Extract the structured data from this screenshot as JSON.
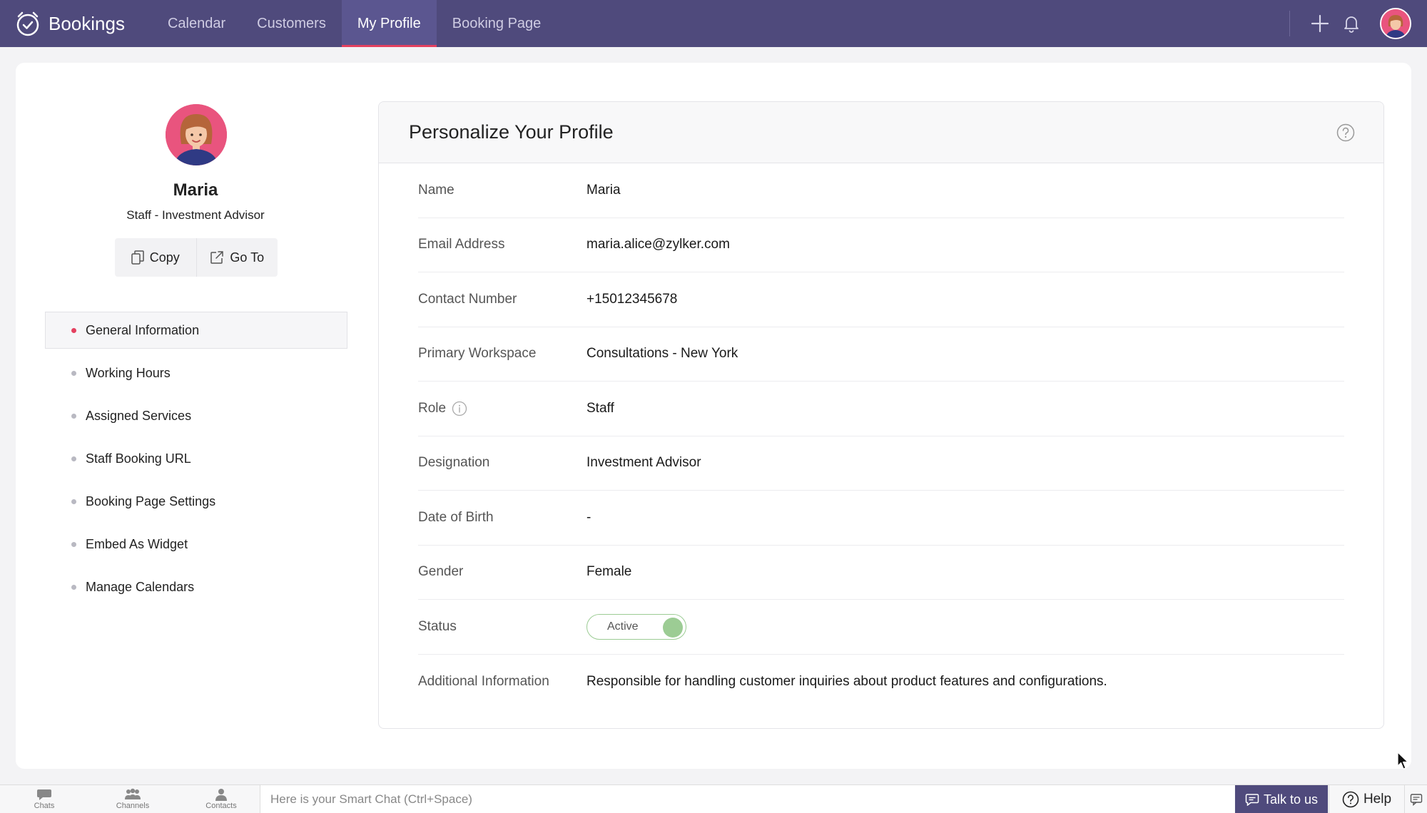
{
  "app": {
    "name": "Bookings"
  },
  "nav": {
    "items": [
      {
        "label": "Calendar"
      },
      {
        "label": "Customers"
      },
      {
        "label": "My Profile",
        "active": true
      },
      {
        "label": "Booking Page"
      }
    ]
  },
  "profile": {
    "name": "Maria",
    "role": "Staff - Investment Advisor",
    "copy_label": "Copy",
    "goto_label": "Go To"
  },
  "side_menu": {
    "items": [
      {
        "label": "General Information",
        "active": true
      },
      {
        "label": "Working Hours"
      },
      {
        "label": "Assigned Services"
      },
      {
        "label": "Staff Booking URL"
      },
      {
        "label": "Booking Page Settings"
      },
      {
        "label": "Embed As Widget"
      },
      {
        "label": "Manage Calendars"
      }
    ]
  },
  "panel": {
    "title": "Personalize Your Profile",
    "fields": [
      {
        "label": "Name",
        "value": "Maria"
      },
      {
        "label": "Email Address",
        "value": "maria.alice@zylker.com"
      },
      {
        "label": "Contact Number",
        "value": "+15012345678"
      },
      {
        "label": "Primary Workspace",
        "value": "Consultations - New York"
      },
      {
        "label": "Role",
        "value": "Staff"
      },
      {
        "label": "Designation",
        "value": "Investment Advisor"
      },
      {
        "label": "Date of Birth",
        "value": "-"
      },
      {
        "label": "Gender",
        "value": "Female"
      },
      {
        "label": "Status",
        "value": "Active"
      },
      {
        "label": "Additional Information",
        "value": "Responsible for handling customer inquiries about product features and configurations."
      }
    ]
  },
  "bottombar": {
    "dock": [
      {
        "label": "Chats",
        "icon": "chat-icon"
      },
      {
        "label": "Channels",
        "icon": "channels-icon"
      },
      {
        "label": "Contacts",
        "icon": "contacts-icon"
      }
    ],
    "smart_chat_placeholder": "Here is your Smart Chat (Ctrl+Space)",
    "talk_label": "Talk to us",
    "help_label": "Help"
  },
  "colors": {
    "topbar": "#4f4a7c",
    "accent": "#e4405f",
    "status_active": "#9ccc94"
  }
}
